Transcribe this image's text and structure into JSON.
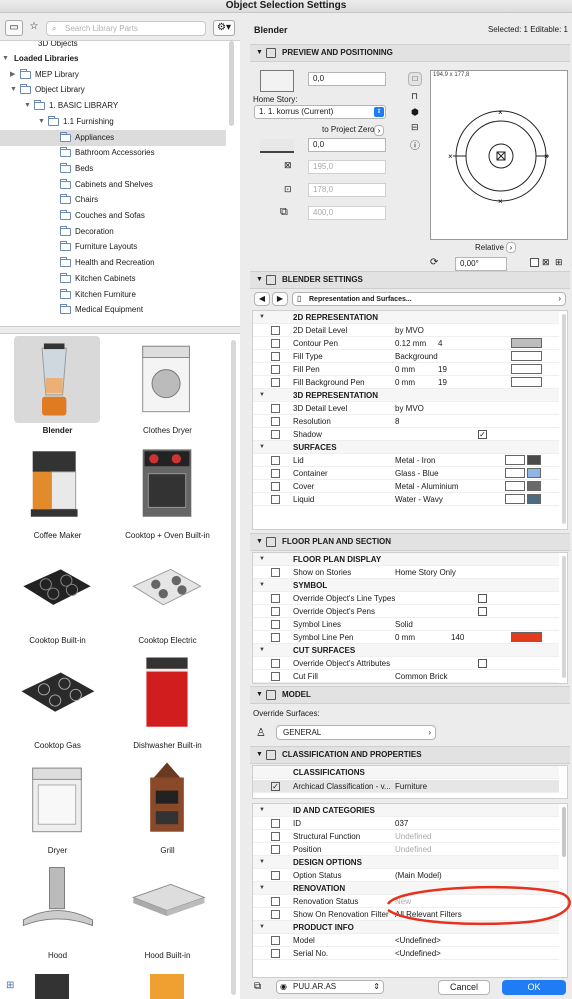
{
  "window": {
    "title": "Object Selection Settings"
  },
  "search": {
    "placeholder": "Search Library Parts"
  },
  "tree": {
    "partial_top": "3D Objects",
    "items": [
      {
        "label": "Loaded Libraries",
        "level": 0,
        "bold": true
      },
      {
        "label": "MEP Library",
        "level": 1
      },
      {
        "label": "Object Library",
        "level": 1
      },
      {
        "label": "1. BASIC LIBRARY",
        "level": 2
      },
      {
        "label": "1.1 Furnishing",
        "level": 3
      },
      {
        "label": "Appliances",
        "level": 4,
        "selected": true
      },
      {
        "label": "Bathroom Accessories",
        "level": 4
      },
      {
        "label": "Beds",
        "level": 4
      },
      {
        "label": "Cabinets and Shelves",
        "level": 4
      },
      {
        "label": "Chairs",
        "level": 4
      },
      {
        "label": "Couches and Sofas",
        "level": 4
      },
      {
        "label": "Decoration",
        "level": 4
      },
      {
        "label": "Furniture Layouts",
        "level": 4
      },
      {
        "label": "Health and Recreation",
        "level": 4
      },
      {
        "label": "Kitchen Cabinets",
        "level": 4
      },
      {
        "label": "Kitchen Furniture",
        "level": 4
      },
      {
        "label": "Medical Equipment",
        "level": 4
      }
    ]
  },
  "gallery": [
    {
      "label": "Blender",
      "icon": "blender-icon",
      "selected": true
    },
    {
      "label": "Clothes Dryer",
      "icon": "clothes-dryer-icon"
    },
    {
      "label": "Coffee Maker",
      "icon": "coffee-maker-icon"
    },
    {
      "label": "Cooktop + Oven Built-in",
      "icon": "cooktop-oven-icon"
    },
    {
      "label": "Cooktop Built-in",
      "icon": "cooktop-builtin-icon"
    },
    {
      "label": "Cooktop Electric",
      "icon": "cooktop-electric-icon"
    },
    {
      "label": "Cooktop Gas",
      "icon": "cooktop-gas-icon"
    },
    {
      "label": "Dishwasher Built-in",
      "icon": "dishwasher-icon"
    },
    {
      "label": "Dryer",
      "icon": "dryer-icon"
    },
    {
      "label": "Grill",
      "icon": "grill-icon"
    },
    {
      "label": "Hood",
      "icon": "hood-icon"
    },
    {
      "label": "Hood Built-in",
      "icon": "hood-builtin-icon"
    }
  ],
  "header": {
    "object_name": "Blender",
    "selection_info": "Selected: 1 Editable: 1"
  },
  "preview": {
    "section_title": "PREVIEW AND POSITIONING",
    "elevation": "0,0",
    "home_story_label": "Home Story:",
    "home_story_value": "1. 1. korrus (Current)",
    "to_project_zero": "to Project Zero",
    "project_zero_value": "0,0",
    "x_size": "195,0",
    "y_size": "178,0",
    "z_size": "400,0",
    "dimensions_readout": "194,9 x 177,8",
    "relative_label": "Relative",
    "angle": "0,00°"
  },
  "settings": {
    "section_title": "BLENDER SETTINGS",
    "page_selector": "Representation and Surfaces...",
    "rows": [
      {
        "type": "group",
        "label": "2D REPRESENTATION"
      },
      {
        "type": "row",
        "label": "2D Detail Level",
        "value": "by MVO"
      },
      {
        "type": "row",
        "label": "Contour Pen",
        "value": "0.12 mm",
        "pen": "4",
        "swatch": "#bdbdbd",
        "check": true
      },
      {
        "type": "row",
        "label": "Fill Type",
        "value": "Background",
        "swatch": "#ffffff"
      },
      {
        "type": "row",
        "label": "Fill Pen",
        "value": "0 mm",
        "pen": "19",
        "swatch": "#ffffff"
      },
      {
        "type": "row",
        "label": "Fill Background Pen",
        "value": "0 mm",
        "pen": "19",
        "swatch": "#ffffff"
      },
      {
        "type": "group",
        "label": "3D REPRESENTATION"
      },
      {
        "type": "row",
        "label": "3D Detail Level",
        "value": "by MVO"
      },
      {
        "type": "row",
        "label": "Resolution",
        "value": "8"
      },
      {
        "type": "row",
        "label": "Shadow",
        "value": "",
        "checked": "✓"
      },
      {
        "type": "group",
        "label": "SURFACES"
      },
      {
        "type": "row",
        "label": "Lid",
        "value": "Metal - Iron",
        "swatch": "#ffffff",
        "swatch2": "#4a4a4a"
      },
      {
        "type": "row",
        "label": "Container",
        "value": "Glass - Blue",
        "swatch": "#ffffff",
        "swatch2": "#8fb4e6"
      },
      {
        "type": "row",
        "label": "Cover",
        "value": "Metal - Aluminium",
        "swatch": "#ffffff",
        "swatch2": "#6b6b6b"
      },
      {
        "type": "row",
        "label": "Liquid",
        "value": "Water - Wavy",
        "swatch": "#ffffff",
        "swatch2": "#4f6b80"
      }
    ]
  },
  "floor_plan": {
    "section_title": "FLOOR PLAN AND SECTION",
    "rows": [
      {
        "type": "group",
        "label": "FLOOR PLAN DISPLAY"
      },
      {
        "type": "row",
        "label": "Show on Stories",
        "value": "Home Story Only"
      },
      {
        "type": "group",
        "label": "SYMBOL"
      },
      {
        "type": "row",
        "label": "Override Object's Line Types",
        "value": ""
      },
      {
        "type": "row",
        "label": "Override Object's Pens",
        "value": ""
      },
      {
        "type": "row",
        "label": "Symbol Lines",
        "value": "Solid"
      },
      {
        "type": "row",
        "label": "Symbol Line Pen",
        "value": "0 mm",
        "pen": "140",
        "swatch": "#e23b1e"
      },
      {
        "type": "group",
        "label": "CUT SURFACES"
      },
      {
        "type": "row",
        "label": "Override Object's Attributes",
        "value": ""
      },
      {
        "type": "row",
        "label": "Cut Fill",
        "value": "Common Brick"
      }
    ]
  },
  "model": {
    "section_title": "MODEL",
    "override_label": "Override Surfaces:",
    "override_value": "GENERAL"
  },
  "classification": {
    "section_title": "CLASSIFICATION AND PROPERTIES",
    "group": "CLASSIFICATIONS",
    "class_name": "Archicad Classification - v...",
    "class_value": "Furniture",
    "rows": [
      {
        "type": "group",
        "label": "ID AND CATEGORIES"
      },
      {
        "type": "row",
        "label": "ID",
        "value": "037"
      },
      {
        "type": "row",
        "label": "Structural Function",
        "value": "Undefined",
        "dim": true
      },
      {
        "type": "row",
        "label": "Position",
        "value": "Undefined",
        "dim": true
      },
      {
        "type": "group",
        "label": "DESIGN OPTIONS"
      },
      {
        "type": "row",
        "label": "Option Status",
        "value": "(Main Model)"
      },
      {
        "type": "group",
        "label": "RENOVATION"
      },
      {
        "type": "row",
        "label": "Renovation Status",
        "value": "New",
        "dim": true
      },
      {
        "type": "row",
        "label": "Show On Renovation Filter",
        "value": "All Relevant Filters"
      },
      {
        "type": "group",
        "label": "PRODUCT INFO"
      },
      {
        "type": "row",
        "label": "Model",
        "value": "<Undefined>"
      },
      {
        "type": "row",
        "label": "Serial No.",
        "value": "<Undefined>"
      }
    ]
  },
  "footer": {
    "layer": "PUU.AR.AS",
    "cancel": "Cancel",
    "ok": "OK"
  },
  "colors": {
    "accent": "#1f7cf5",
    "annotation": "#e8301c"
  }
}
